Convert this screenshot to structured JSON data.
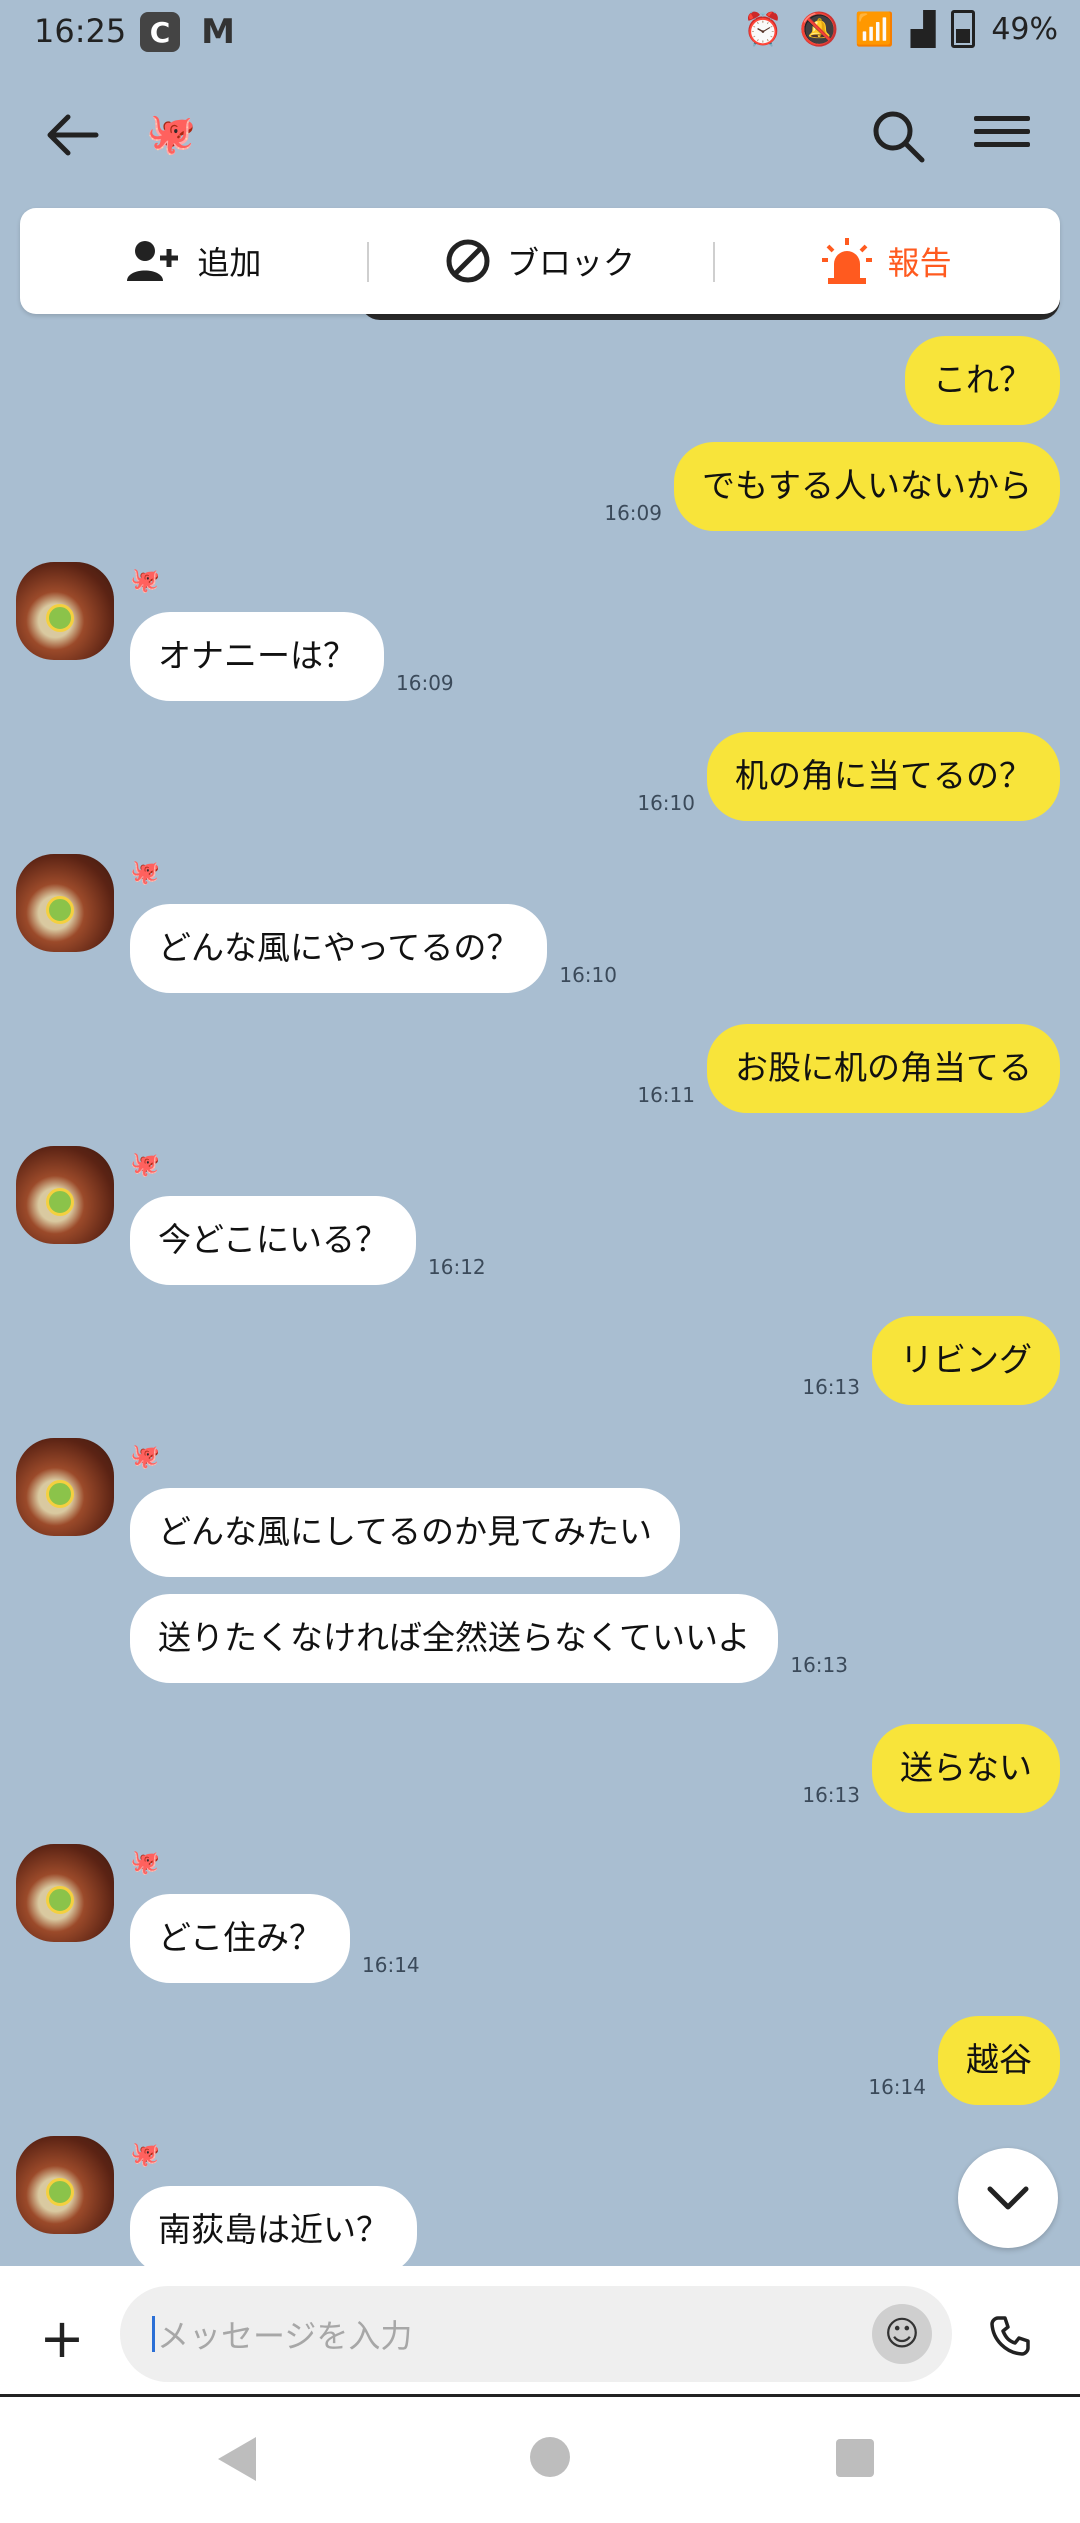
{
  "status_bar": {
    "time": "16:25",
    "app_icon": "C",
    "gmail_icon": "M",
    "battery": "49%",
    "network": "5"
  },
  "header": {
    "contact_icon": "🐙"
  },
  "actions": [
    {
      "label": "追加",
      "icon": "add-friend-icon"
    },
    {
      "label": "ブロック",
      "icon": "block-icon"
    },
    {
      "label": "報告",
      "icon": "siren-icon"
    }
  ],
  "messages": [
    {
      "side": "me",
      "text": "これ？",
      "time": ""
    },
    {
      "side": "me",
      "text": "でもする人いないから",
      "time": "16:09"
    },
    {
      "side": "them",
      "text": "オナニーは？",
      "time": "16:09"
    },
    {
      "side": "me",
      "text": "机の角に当てるの？",
      "time": "16:10"
    },
    {
      "side": "them",
      "text": "どんな風にやってるの？",
      "time": "16:10"
    },
    {
      "side": "me",
      "text": "お股に机の角当てる",
      "time": "16:11"
    },
    {
      "side": "them",
      "text": "今どこにいる？",
      "time": "16:12"
    },
    {
      "side": "me",
      "text": "リビング",
      "time": "16:13"
    },
    {
      "side": "them",
      "text": "どんな風にしてるのか見てみたい",
      "time": ""
    },
    {
      "side": "them",
      "text": "送りたくなければ全然送らなくていいよ",
      "time": "16:13"
    },
    {
      "side": "me",
      "text": "送らない",
      "time": "16:13"
    },
    {
      "side": "them",
      "text": "どこ住み？",
      "time": "16:14"
    },
    {
      "side": "me",
      "text": "越谷",
      "time": "16:14"
    },
    {
      "side": "them",
      "text": "南荻島は近い？",
      "time": ""
    }
  ],
  "input": {
    "placeholder": "メッセージを入力"
  },
  "colors": {
    "background": "#a9bed1",
    "my_bubble": "#f8e43a",
    "their_bubble": "#ffffff",
    "report": "#ff5a1f"
  }
}
